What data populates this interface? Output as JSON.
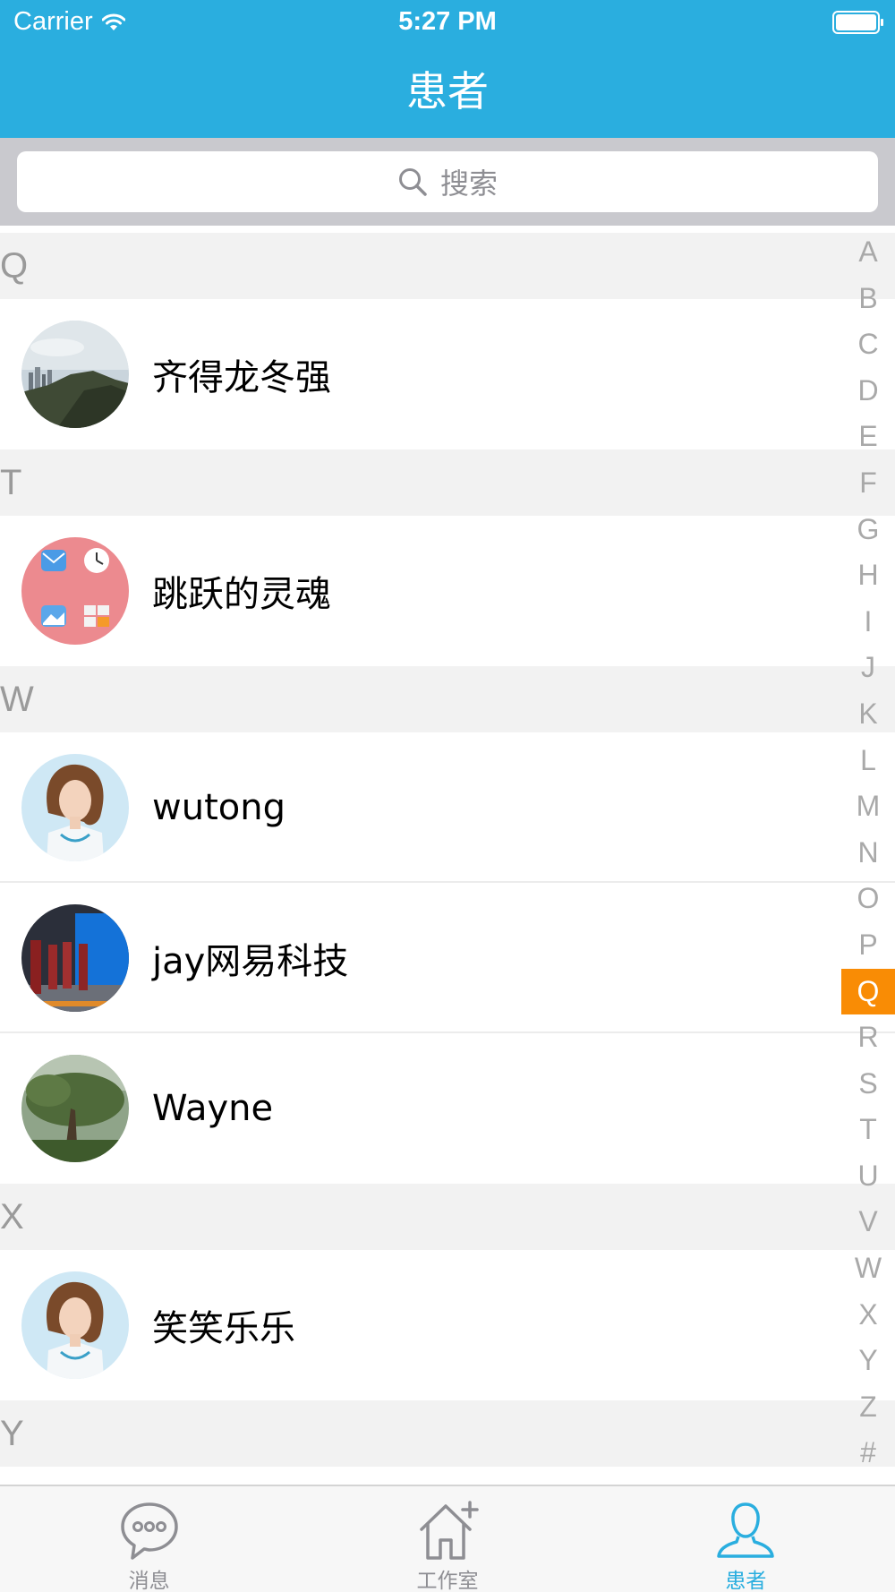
{
  "status_bar": {
    "carrier": "Carrier",
    "time": "5:27 PM"
  },
  "nav": {
    "title": "患者"
  },
  "search": {
    "placeholder": "搜索"
  },
  "sections": [
    {
      "letter": "Q",
      "rows": [
        {
          "name": "齐得龙冬强",
          "avatar": "landscape-avatar"
        }
      ]
    },
    {
      "letter": "T",
      "rows": [
        {
          "name": "跳跃的灵魂",
          "avatar": "app-icons-avatar"
        }
      ]
    },
    {
      "letter": "W",
      "rows": [
        {
          "name": "wutong",
          "avatar": "doctor-avatar"
        },
        {
          "name": "jay网易科技",
          "avatar": "event-photo-avatar"
        },
        {
          "name": "Wayne",
          "avatar": "tree-photo-avatar"
        }
      ]
    },
    {
      "letter": "X",
      "rows": [
        {
          "name": "笑笑乐乐",
          "avatar": "doctor-avatar"
        }
      ]
    },
    {
      "letter": "Y",
      "rows": []
    }
  ],
  "index_letters": [
    "A",
    "B",
    "C",
    "D",
    "E",
    "F",
    "G",
    "H",
    "I",
    "J",
    "K",
    "L",
    "M",
    "N",
    "O",
    "P",
    "Q",
    "R",
    "S",
    "T",
    "U",
    "V",
    "W",
    "X",
    "Y",
    "Z",
    "#"
  ],
  "index_active": "Q",
  "tabs": [
    {
      "label": "消息",
      "icon": "chat-bubble-icon",
      "active": false
    },
    {
      "label": "工作室",
      "icon": "house-plus-icon",
      "active": false
    },
    {
      "label": "患者",
      "icon": "person-icon",
      "active": true
    }
  ],
  "colors": {
    "header": "#2aaedf",
    "active_index": "#f98c05",
    "active_tab": "#2aaedf",
    "inactive_tab": "#8e8e93"
  }
}
